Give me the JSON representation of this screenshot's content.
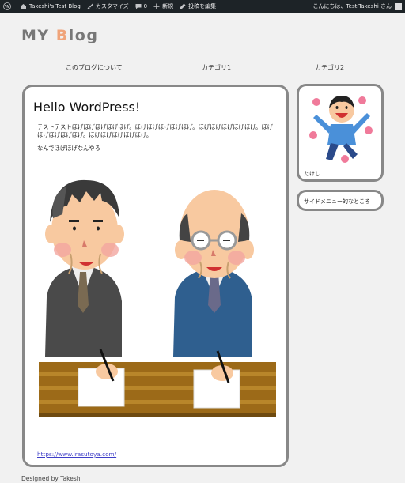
{
  "adminbar": {
    "site": "Takeshi's Test Blog",
    "customize": "カスタマイズ",
    "comments": "0",
    "new": "新規",
    "edit": "投稿を編集",
    "greeting": "こんにちは、Test-Takeshi さん"
  },
  "header": {
    "title_prefix": "MY ",
    "title_accent": "B",
    "title_suffix": "log"
  },
  "nav": {
    "items": [
      "このブログについて",
      "カテゴリ1",
      "カテゴリ2"
    ]
  },
  "post": {
    "title": "Hello WordPress!",
    "paragraph1": "テストテストほげほげほげほげほげ。ほげほげほげほげほげ。ほげほげほげほげほげ。ほげほげほげほげほげ。ほげほげほげほげほげ。",
    "paragraph2": "なんでほげほげなんやろ",
    "link": "https://www.irasutoya.com/"
  },
  "sidebar": {
    "profile_name": "たけし",
    "menu_text": "サイドメニュー的なところ"
  },
  "footer": {
    "text": "Designed by Takeshi"
  },
  "colors": {
    "adminbar_bg": "#1d2327",
    "title_gray": "#777777",
    "title_accent": "#f0a47a",
    "card_border": "#888888",
    "link": "#3d3dc7"
  }
}
